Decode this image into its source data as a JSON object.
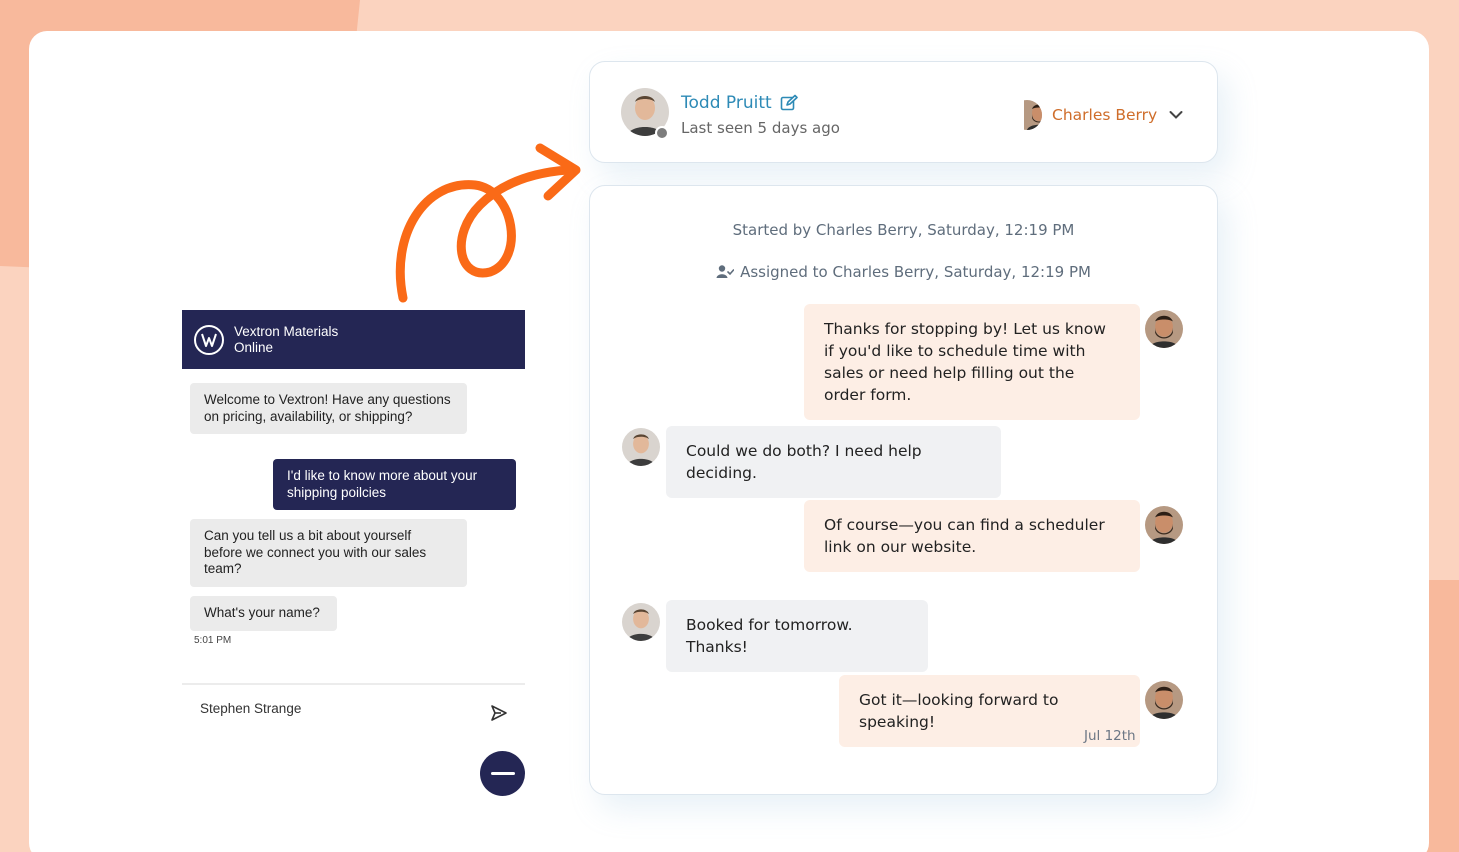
{
  "widget": {
    "company_name": "Vextron Materials",
    "status": "Online",
    "messages": [
      {
        "from": "bot",
        "text": "Welcome to Vextron! Have any questions on pricing, availability, or shipping?"
      },
      {
        "from": "user",
        "text": "I'd like to know more about your shipping poilcies"
      },
      {
        "from": "bot",
        "text": "Can you tell us a bit about yourself before we connect you with our sales team?"
      },
      {
        "from": "bot",
        "text": "What's your name?"
      }
    ],
    "timestamp": "5:01 PM",
    "input_value": "Stephen Strange",
    "colors": {
      "primary": "#242654",
      "bot_bubble": "#ebebeb"
    }
  },
  "inbox": {
    "contact": {
      "name": "Todd Pruitt",
      "last_seen": "Last seen 5 days ago",
      "status_color": "#7d7d7d"
    },
    "owner": {
      "name": "Charles Berry"
    },
    "started": "Started by Charles Berry, Saturday, 12:19 PM",
    "assigned": "Assigned to Charles Berry, Saturday, 12:19 PM",
    "messages": [
      {
        "from": "agent",
        "text": "Thanks for stopping by! Let us know if you'd like to schedule time with sales or need help filling out the order form."
      },
      {
        "from": "contact",
        "text": "Could we do both? I need help deciding."
      },
      {
        "from": "agent",
        "text": "Of course—you can find a scheduler link on our website."
      },
      {
        "from": "contact",
        "text": "Booked for tomorrow. Thanks!"
      },
      {
        "from": "agent",
        "text": "Got it—looking forward to speaking!"
      }
    ],
    "date": "Jul 12th",
    "colors": {
      "name_link": "#2d8ab6",
      "owner": "#cf6d2a",
      "agent_bubble": "#fdeee5",
      "contact_bubble": "#f0f1f3"
    }
  },
  "decor": {
    "arrow_color": "#fa6a17",
    "background": "#fbd3bf"
  }
}
